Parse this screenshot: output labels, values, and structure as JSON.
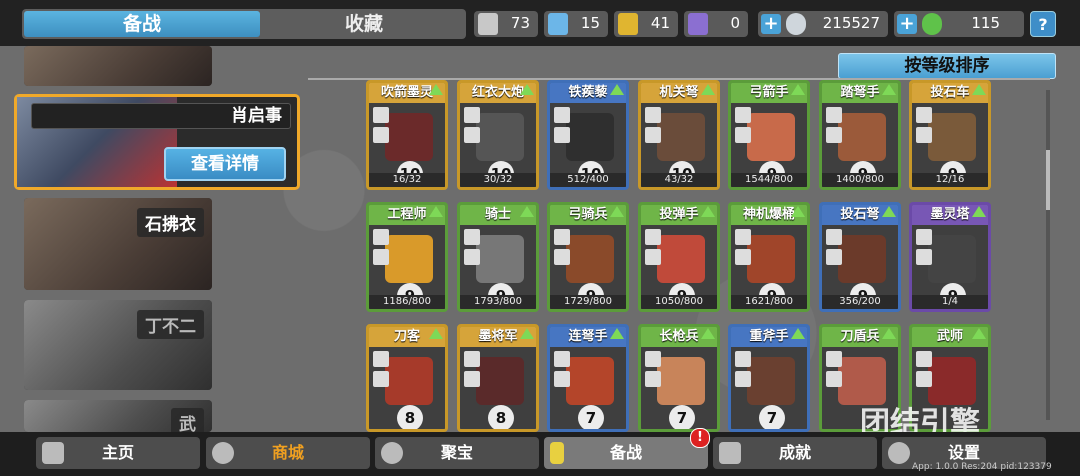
{
  "tabs": {
    "active": "备战",
    "inactive": "收藏"
  },
  "resources": [
    {
      "icon": "silver-shield-icon",
      "color": "#c8c8c8",
      "value": "73"
    },
    {
      "icon": "blue-crystal-icon",
      "color": "#6cb6e8",
      "value": "15"
    },
    {
      "icon": "gold-shield-icon",
      "color": "#e0b530",
      "value": "41"
    },
    {
      "icon": "purple-shield-icon",
      "color": "#8b6fd1",
      "value": "0"
    },
    {
      "icon": "silver-coin-icon",
      "color": "#cfd6dc",
      "value": "215527"
    },
    {
      "icon": "jade-icon",
      "color": "#5fc24a",
      "value": "115"
    }
  ],
  "help_label": "?",
  "heroes": {
    "selected": {
      "name": "肖启事",
      "detail_label": "查看详情"
    },
    "others": [
      "石拂衣",
      "丁不二",
      "武"
    ]
  },
  "sort_label": "按等级排序",
  "units": [
    {
      "name": "吹箭墨灵",
      "level": "10",
      "progress": "16/32",
      "rarity": "gold",
      "sprite": "#6b2a2a"
    },
    {
      "name": "红衣大炮",
      "level": "10",
      "progress": "30/32",
      "rarity": "gold",
      "sprite": "#555"
    },
    {
      "name": "铁蒺藜",
      "level": "10",
      "progress": "512/400",
      "rarity": "blue",
      "sprite": "#2f2f2f"
    },
    {
      "name": "机关弩",
      "level": "10",
      "progress": "43/32",
      "rarity": "gold",
      "sprite": "#6a4c3a"
    },
    {
      "name": "弓箭手",
      "level": "9",
      "progress": "1544/800",
      "rarity": "green",
      "sprite": "#c86a4a"
    },
    {
      "name": "踏弩手",
      "level": "9",
      "progress": "1400/800",
      "rarity": "green",
      "sprite": "#9b5a3a"
    },
    {
      "name": "投石车",
      "level": "9",
      "progress": "12/16",
      "rarity": "gold",
      "sprite": "#7a5a3a"
    },
    {
      "name": "工程师",
      "level": "9",
      "progress": "1186/800",
      "rarity": "green",
      "sprite": "#d99a2a"
    },
    {
      "name": "骑士",
      "level": "9",
      "progress": "1793/800",
      "rarity": "green",
      "sprite": "#777"
    },
    {
      "name": "弓骑兵",
      "level": "9",
      "progress": "1729/800",
      "rarity": "green",
      "sprite": "#8a4a2a"
    },
    {
      "name": "投弹手",
      "level": "9",
      "progress": "1050/800",
      "rarity": "green",
      "sprite": "#c04a3a"
    },
    {
      "name": "神机爆桶",
      "level": "9",
      "progress": "1621/800",
      "rarity": "green",
      "sprite": "#a0452a"
    },
    {
      "name": "投石弩",
      "level": "9",
      "progress": "356/200",
      "rarity": "blue",
      "sprite": "#6b3a2a"
    },
    {
      "name": "墨灵塔",
      "level": "9",
      "progress": "1/4",
      "rarity": "purple",
      "sprite": "#444"
    },
    {
      "name": "刀客",
      "level": "8",
      "progress": "",
      "rarity": "gold",
      "sprite": "#a63a2a"
    },
    {
      "name": "墨将军",
      "level": "8",
      "progress": "",
      "rarity": "gold",
      "sprite": "#5a2a2a"
    },
    {
      "name": "连弩手",
      "level": "7",
      "progress": "",
      "rarity": "blue",
      "sprite": "#b4452a"
    },
    {
      "name": "长枪兵",
      "level": "7",
      "progress": "",
      "rarity": "green",
      "sprite": "#c8845a"
    },
    {
      "name": "重斧手",
      "level": "7",
      "progress": "",
      "rarity": "blue",
      "sprite": "#6a4030"
    },
    {
      "name": "刀盾兵",
      "level": "",
      "progress": "",
      "rarity": "green",
      "sprite": "#b05a4a"
    },
    {
      "name": "武师",
      "level": "",
      "progress": "",
      "rarity": "green",
      "sprite": "#8a2a2a"
    }
  ],
  "nav": [
    {
      "label": "主页",
      "icon": "home-icon"
    },
    {
      "label": "商城",
      "icon": "coins-icon"
    },
    {
      "label": "聚宝",
      "icon": "treasure-bowl-icon"
    },
    {
      "label": "备战",
      "icon": "card-icon"
    },
    {
      "label": "成就",
      "icon": "achievement-icon"
    },
    {
      "label": "设置",
      "icon": "gear-icon"
    }
  ],
  "nav_badge": "!",
  "watermark": "团结引擎",
  "app_info": "App: 1.0.0 Res:204 pid:123379"
}
